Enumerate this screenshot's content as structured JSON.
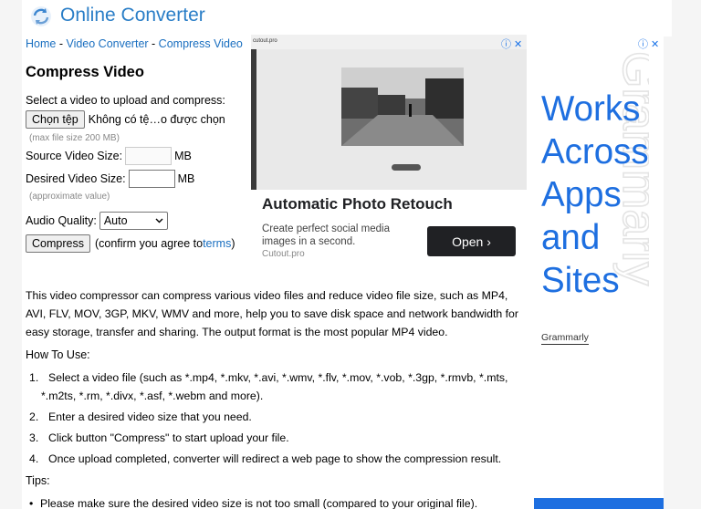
{
  "header": {
    "site_title": "Online Converter",
    "logo_icon": "refresh-arrows-icon"
  },
  "breadcrumb": {
    "home": "Home",
    "sep": " - ",
    "section": "Video Converter",
    "current": "Compress Video"
  },
  "page": {
    "title": "Compress Video",
    "select_prompt": "Select a video to upload and compress:",
    "choose_button": "Chọn tệp",
    "no_file_text": "Không có tệ…o được chọn",
    "max_size_hint": "(max file size 200 MB)",
    "source_label": "Source Video Size:",
    "source_value": "",
    "source_unit": "MB",
    "desired_label": "Desired Video Size:",
    "desired_value": "",
    "desired_unit": "MB",
    "approx_hint": "(approximate value)",
    "audio_label": "Audio Quality:",
    "audio_value": "Auto",
    "compress_button": "Compress",
    "confirm_prefix": "(confirm you agree to ",
    "terms_link": "terms",
    "confirm_suffix": ")"
  },
  "description": "This video compressor can compress various video files and reduce video file size, such as MP4, AVI, FLV, MOV, 3GP, MKV, WMV and more, help you to save disk space and network bandwidth for easy storage, transfer and sharing. The output format is the most popular MP4 video.",
  "howto": {
    "title": "How To Use:",
    "steps": [
      {
        "num": "1.",
        "text": "Select a video file (such as *.mp4, *.mkv, *.avi, *.wmv, *.flv, *.mov, *.vob, *.3gp, *.rmvb, *.mts, *.m2ts, *.rm, *.divx, *.asf, *.webm and more)."
      },
      {
        "num": "2.",
        "text": "Enter a desired video size that you need."
      },
      {
        "num": "3.",
        "text": "Click button \"Compress\" to start upload your file."
      },
      {
        "num": "4.",
        "text": "Once upload completed, converter will redirect a web page to show the compression result."
      }
    ]
  },
  "tips": {
    "title": "Tips:",
    "items": [
      "Please make sure the desired video size is not too small (compared to your original file)."
    ]
  },
  "ad1": {
    "browser_bar": "cutout.pro",
    "headline": "Automatic Photo Retouch",
    "body": "Create perfect social media images in a second.",
    "source": "Cutout.pro",
    "cta": "Open ›",
    "choices": "ⓘ ✕"
  },
  "ad2": {
    "headline": "Works Across Apps and Sites",
    "brand": "Grammarly",
    "watermark": "Grammarly",
    "choices": "ⓘ ✕"
  },
  "colors": {
    "link": "#1a6fc0",
    "title_blue": "#2a7ec7",
    "ad_blue": "#1e6fe0",
    "cta_dark": "#202124"
  }
}
